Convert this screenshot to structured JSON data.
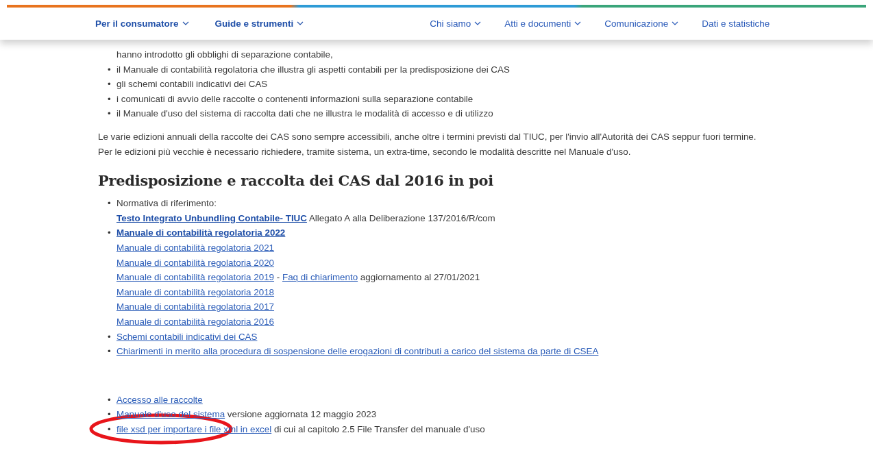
{
  "nav": {
    "left": [
      {
        "label": "Per il consumatore",
        "has_menu": true
      },
      {
        "label": "Guide e strumenti",
        "has_menu": true
      }
    ],
    "right": [
      {
        "label": "Chi siamo",
        "has_menu": true
      },
      {
        "label": "Atti e documenti",
        "has_menu": true
      },
      {
        "label": "Comunicazione",
        "has_menu": true
      },
      {
        "label": "Dati e statistiche",
        "has_menu": false
      }
    ]
  },
  "bullet": "•",
  "intro_list": [
    {
      "kind": "continuation",
      "text": "hanno introdotto gli obblighi di separazione contabile,"
    },
    {
      "kind": "item",
      "text": "il Manuale di contabilità regolatoria che illustra gli aspetti contabili per la predisposizione dei CAS"
    },
    {
      "kind": "item",
      "text": "gli schemi contabili indicativi dei CAS"
    },
    {
      "kind": "item",
      "text": "i comunicati di avvio delle raccolte o contenenti informazioni sulla separazione contabile"
    },
    {
      "kind": "item",
      "text": "il Manuale d'uso del sistema di raccolta dati che ne illustra le modalità di accesso e di utilizzo"
    }
  ],
  "paragraphs": [
    "Le varie edizioni annuali della raccolte dei CAS sono sempre accessibili, anche oltre i termini previsti dal TIUC, per l'invio all'Autorità dei CAS seppur fuori termine.",
    "Per le edizioni più vecchie è necessario richiedere, tramite sistema, un extra-time, secondo le modalità descritte nel Manuale d'uso."
  ],
  "heading": "Predisposizione e raccolta dei CAS dal 2016 in poi",
  "lists": [
    {
      "items": [
        {
          "lines": [
            [
              {
                "kind": "text",
                "text": "Normativa di riferimento:"
              }
            ],
            [
              {
                "kind": "bold_link",
                "text": "Testo Integrato Unbundling Contabile- TIUC"
              },
              {
                "kind": "text",
                "text": "Allegato A alla Deliberazione 137/2016/R/com"
              }
            ]
          ]
        },
        {
          "lines": [
            [
              {
                "kind": "bold_link",
                "text": "Manuale di contabilità regolatoria 2022"
              }
            ],
            [
              {
                "kind": "link",
                "text": "Manuale di contabilità regolatoria 2021"
              }
            ],
            [
              {
                "kind": "link",
                "text": "Manuale di contabilità regolatoria 2020"
              }
            ],
            [
              {
                "kind": "link",
                "text": "Manuale di contabilità regolatoria 2019"
              },
              {
                "kind": "text",
                "text": "-"
              },
              {
                "kind": "link",
                "text": "Faq di chiarimento"
              },
              {
                "kind": "text",
                "text": "aggiornamento al 27/01/2021"
              }
            ],
            [
              {
                "kind": "link",
                "text": "Manuale di contabilità regolatoria 2018"
              }
            ],
            [
              {
                "kind": "link",
                "text": "Manuale di contabilità regolatoria 2017"
              }
            ],
            [
              {
                "kind": "link",
                "text": "Manuale di contabilità regolatoria 2016"
              }
            ]
          ]
        },
        {
          "lines": [
            [
              {
                "kind": "link",
                "text": "Schemi contabili indicativi dei CAS"
              }
            ]
          ]
        },
        {
          "lines": [
            [
              {
                "kind": "link",
                "text": "Chiarimenti in merito alla procedura di sospensione delle erogazioni di contributi a carico del sistema da parte di CSEA"
              }
            ]
          ]
        }
      ]
    },
    {
      "items": [
        {
          "lines": [
            [
              {
                "kind": "link",
                "text": "Accesso alle raccolte"
              }
            ]
          ]
        },
        {
          "lines": [
            [
              {
                "kind": "link",
                "text": "Manuale d'uso del sistema"
              },
              {
                "kind": "text",
                "text": "versione aggiornata 12 maggio 2023"
              }
            ]
          ]
        },
        {
          "lines": [
            [
              {
                "kind": "link",
                "text": "file xsd per importare i file xml in excel"
              },
              {
                "kind": "text",
                "text": "di cui al capitolo 2.5 File Transfer del manuale d'uso"
              }
            ]
          ]
        }
      ]
    }
  ],
  "annotation": {
    "kind": "ellipse"
  }
}
